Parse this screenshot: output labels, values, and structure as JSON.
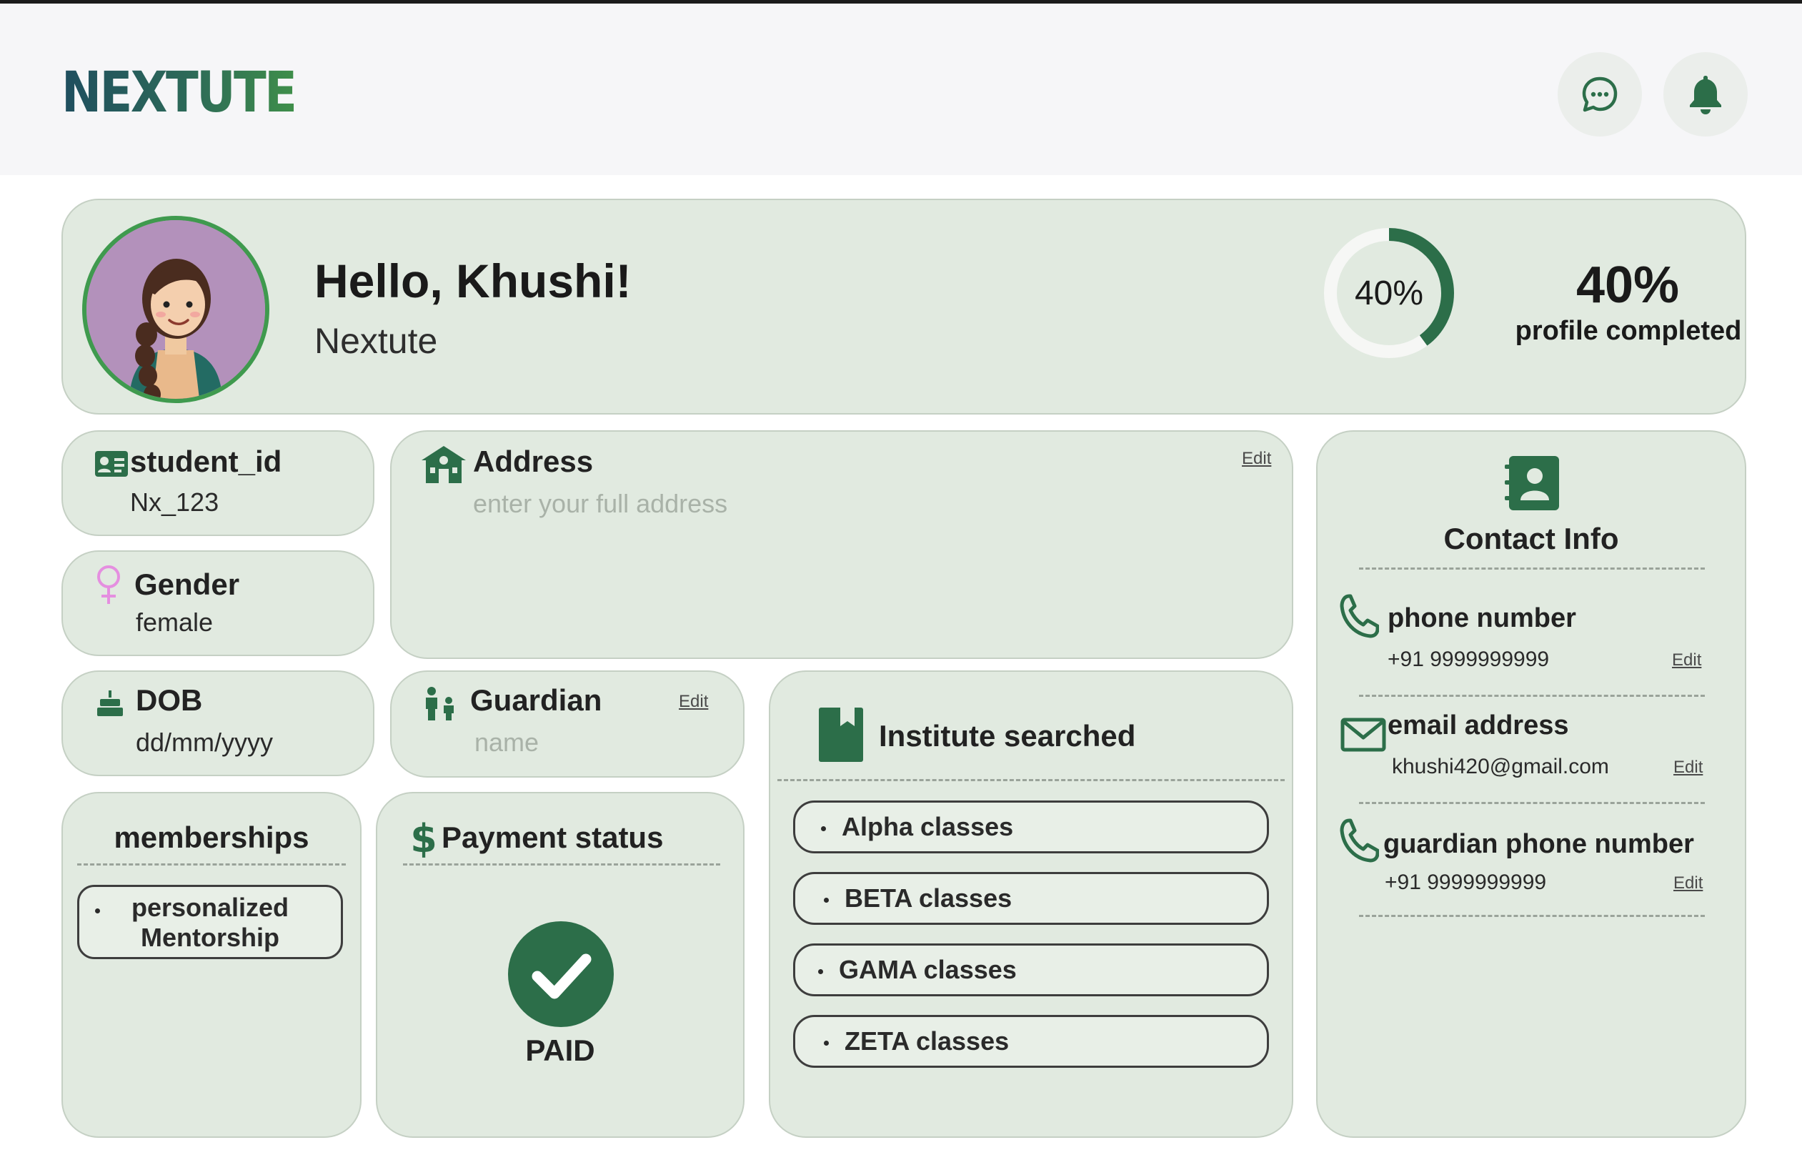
{
  "header": {
    "logo": "NEXTUTE",
    "chat_icon": "chat-bubble-icon",
    "bell_icon": "bell-icon"
  },
  "profile": {
    "greeting": "Hello, Khushi!",
    "org": "Nextute",
    "completion_percent": 40,
    "ring_label": "40%",
    "big_percent": "40%",
    "completion_caption": "profile completed",
    "avatar_colors": {
      "ring": "#3f9a4e",
      "bg": "#b391bb"
    }
  },
  "student_id": {
    "label": "student_id",
    "value": "Nx_123"
  },
  "gender": {
    "label": "Gender",
    "value": "female"
  },
  "dob": {
    "label": "DOB",
    "value": "dd/mm/yyyy"
  },
  "address": {
    "label": "Address",
    "placeholder": "enter your full address",
    "edit": "Edit"
  },
  "guardian": {
    "label": "Guardian",
    "placeholder": "name",
    "edit": "Edit"
  },
  "memberships": {
    "title": "memberships",
    "items": [
      "personalized Mentorship"
    ]
  },
  "payment": {
    "title": "Payment status",
    "status": "PAID"
  },
  "institutes": {
    "title": "Institute searched",
    "items": [
      "Alpha classes",
      "BETA classes",
      "GAMA classes",
      "ZETA classes"
    ]
  },
  "contact": {
    "title": "Contact Info",
    "phone_label": "phone number",
    "phone_value": "+91 9999999999",
    "email_label": "email address",
    "email_value": "khushi420@gmail.com",
    "guardian_phone_label": "guardian phone number",
    "guardian_phone_value": "+91 9999999999",
    "edit": "Edit"
  },
  "colors": {
    "accent": "#2c6e49",
    "card_bg": "#e1eae0",
    "header_bg": "#f6f6f8"
  }
}
